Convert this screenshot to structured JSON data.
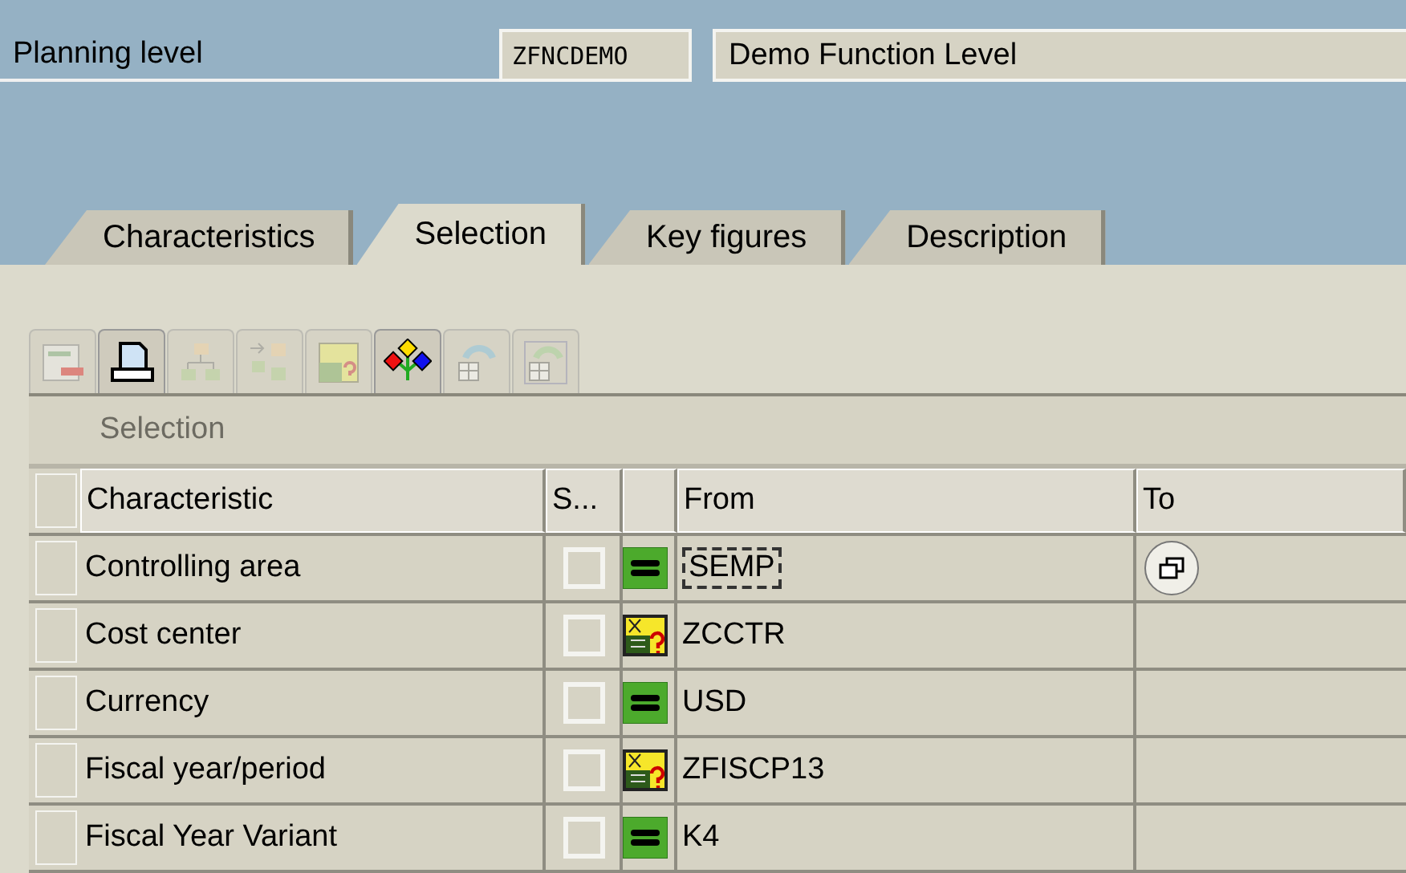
{
  "header": {
    "label": "Planning level",
    "code": "ZFNCDEMO",
    "description": "Demo Function Level"
  },
  "tabs": [
    {
      "label": "Characteristics",
      "selected": false
    },
    {
      "label": "Selection",
      "selected": true
    },
    {
      "label": "Key figures",
      "selected": false
    },
    {
      "label": "Description",
      "selected": false
    }
  ],
  "toolbar": [
    {
      "kind": "delete-row",
      "disabled": true
    },
    {
      "kind": "print",
      "disabled": false
    },
    {
      "kind": "hierarchy",
      "disabled": true
    },
    {
      "kind": "expand",
      "disabled": true
    },
    {
      "kind": "variable",
      "disabled": true
    },
    {
      "kind": "tree",
      "disabled": false
    },
    {
      "kind": "table-refresh",
      "disabled": true
    },
    {
      "kind": "table-cycle",
      "disabled": true
    }
  ],
  "grid": {
    "title": "Selection",
    "columns": [
      "Characteristic",
      "S...",
      "From",
      "To"
    ],
    "rows": [
      {
        "characteristic": "Controlling area",
        "checked": false,
        "kind": "equal",
        "from": "SEMP",
        "focused": true
      },
      {
        "characteristic": "Cost center",
        "checked": false,
        "kind": "variable",
        "from": "ZCCTR",
        "focused": false
      },
      {
        "characteristic": "Currency",
        "checked": false,
        "kind": "equal",
        "from": "USD",
        "focused": false
      },
      {
        "characteristic": "Fiscal year/period",
        "checked": false,
        "kind": "variable",
        "from": "ZFISCP13",
        "focused": false
      },
      {
        "characteristic": "Fiscal Year Variant",
        "checked": false,
        "kind": "equal",
        "from": "K4",
        "focused": false
      }
    ]
  }
}
